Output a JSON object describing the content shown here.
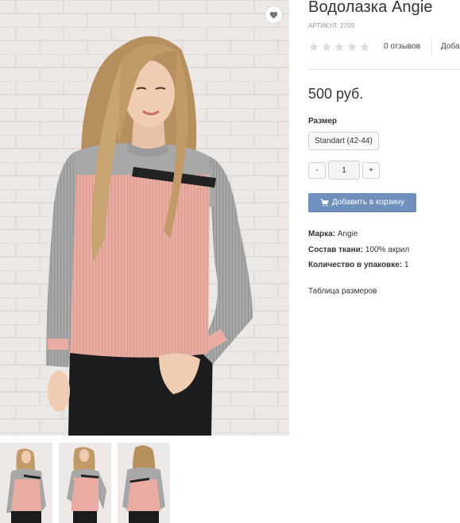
{
  "product": {
    "title": "Водолазка Angie",
    "sku_label": "АРТИКУЛ:",
    "sku_value": "2709",
    "rating": {
      "stars_total": 5,
      "stars_filled": 0,
      "reviews_label": "0 отзывов",
      "add_review_label": "Добавить отзыв"
    },
    "price": "500 руб.",
    "size": {
      "label": "Размер",
      "selected": "Standart (42-44)"
    },
    "quantity": {
      "minus_label": "-",
      "value": "1",
      "plus_label": "+"
    },
    "add_to_cart_label": "Добавить в корзину",
    "properties": [
      {
        "key": "Марка:",
        "value": "Angie"
      },
      {
        "key": "Состав ткани:",
        "value": "100% акрил"
      },
      {
        "key": "Количество в упаковке:",
        "value": "1"
      }
    ],
    "size_table_label": "Таблица размеров"
  },
  "images": {
    "main_alt": "main-product-photo",
    "thumbnails": [
      "front-view",
      "side-view",
      "back-view"
    ]
  },
  "colors": {
    "accent_button": "#6f8fbd",
    "star_empty": "#dcdcdc",
    "sweater_pink": "#e8aca2",
    "sweater_grey": "#a3a3a3",
    "stripe_dark": "#222222"
  },
  "icons": {
    "favorite": "heart-icon",
    "cart": "cart-icon",
    "star": "star-icon"
  }
}
